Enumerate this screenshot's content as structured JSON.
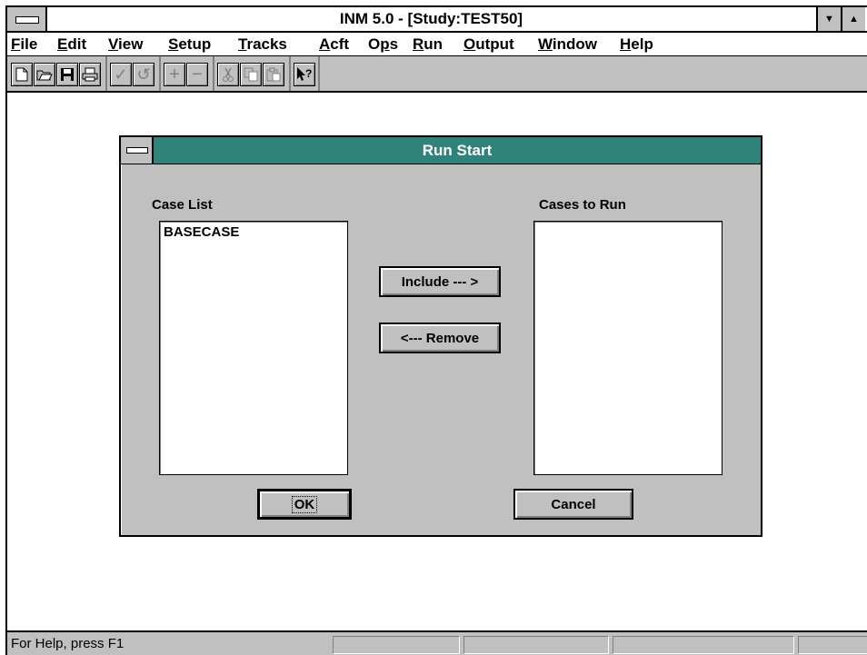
{
  "window": {
    "title": "INM 5.0 - [Study:TEST50]",
    "minimize_symbol": "▼",
    "maximize_symbol": "▲"
  },
  "menu": {
    "items": [
      {
        "label": "File"
      },
      {
        "label": "Edit"
      },
      {
        "label": "View"
      },
      {
        "label": "Setup"
      },
      {
        "label": "Tracks"
      },
      {
        "label": "Acft"
      },
      {
        "label": "Ops"
      },
      {
        "label": "Run"
      },
      {
        "label": "Output"
      },
      {
        "label": "Window"
      },
      {
        "label": "Help"
      }
    ]
  },
  "toolbar": {
    "buttons": [
      {
        "icon": "new-file-icon",
        "glyph": ""
      },
      {
        "icon": "open-folder-icon",
        "glyph": ""
      },
      {
        "icon": "save-disk-icon",
        "glyph": ""
      },
      {
        "icon": "print-icon",
        "glyph": ""
      },
      {
        "icon": "check-icon",
        "glyph": "✓"
      },
      {
        "icon": "undo-icon",
        "glyph": "↺"
      },
      {
        "icon": "add-icon",
        "glyph": "+"
      },
      {
        "icon": "remove-icon",
        "glyph": "−"
      },
      {
        "icon": "cut-icon",
        "glyph": ""
      },
      {
        "icon": "copy-icon",
        "glyph": ""
      },
      {
        "icon": "paste-icon",
        "glyph": ""
      },
      {
        "icon": "context-help-icon",
        "glyph": "?"
      }
    ]
  },
  "dialog": {
    "title": "Run Start",
    "case_list_label": "Case List",
    "cases_to_run_label": "Cases to Run",
    "case_list": [
      "BASECASE"
    ],
    "cases_to_run": [],
    "include_label": "Include --- >",
    "remove_label": "<--- Remove",
    "ok_label": "OK",
    "cancel_label": "Cancel"
  },
  "status": {
    "text": "For Help, press F1"
  },
  "colors": {
    "dialog_title_bar": "#2f837b",
    "face": "#c0c0c0"
  }
}
